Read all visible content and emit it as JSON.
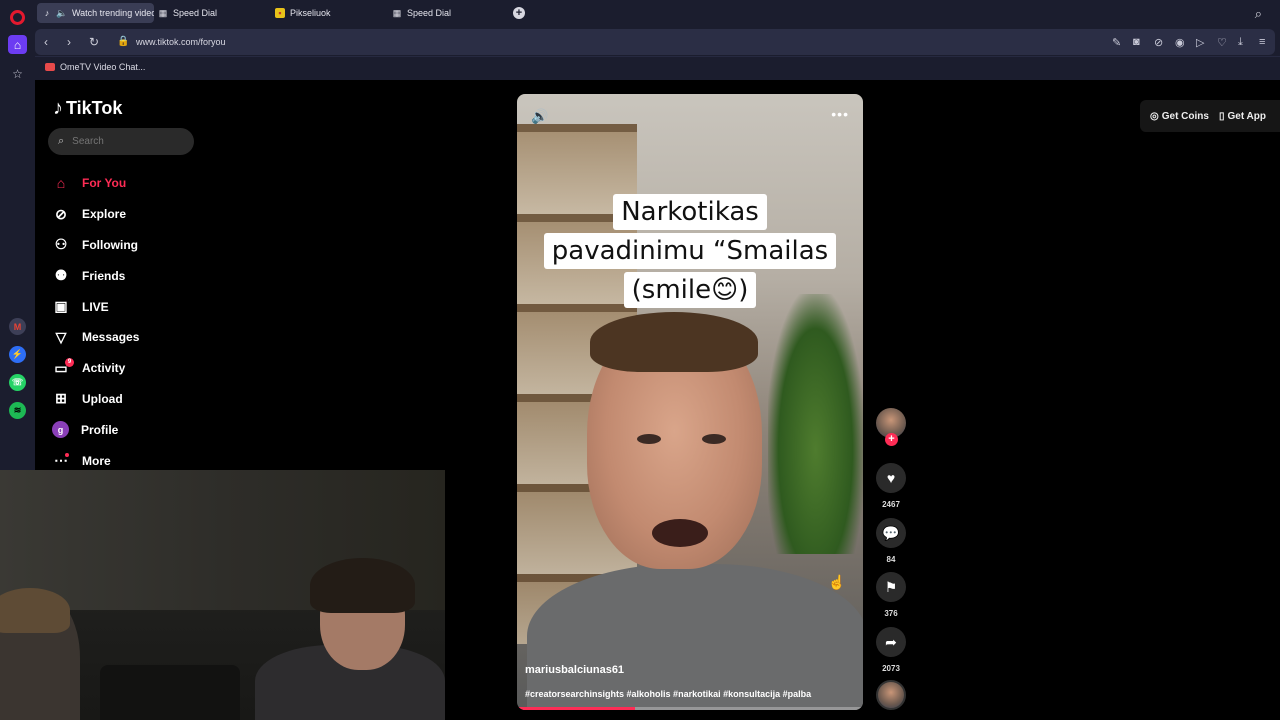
{
  "browser": {
    "tabs": [
      {
        "label": "Watch trending videos",
        "icon": "tiktok-icon",
        "active": true
      },
      {
        "label": "Speed Dial",
        "icon": "grid-icon",
        "active": false
      },
      {
        "label": "Pikseliuok",
        "icon": "pixel-icon",
        "active": false
      },
      {
        "label": "Speed Dial",
        "icon": "grid-icon",
        "active": false
      }
    ],
    "url": "www.tiktok.com/foryou",
    "bookmarks": [
      {
        "label": "OmeTV Video Chat..."
      }
    ]
  },
  "tiktok": {
    "brand": "TikTok",
    "search_placeholder": "Search",
    "nav": [
      {
        "label": "For You",
        "icon": "home-icon",
        "active": true
      },
      {
        "label": "Explore",
        "icon": "compass-icon"
      },
      {
        "label": "Following",
        "icon": "following-icon"
      },
      {
        "label": "Friends",
        "icon": "friends-icon"
      },
      {
        "label": "LIVE",
        "icon": "live-icon"
      },
      {
        "label": "Messages",
        "icon": "messages-icon"
      },
      {
        "label": "Activity",
        "icon": "activity-icon",
        "badge": "9"
      },
      {
        "label": "Upload",
        "icon": "upload-icon"
      },
      {
        "label": "Profile",
        "icon": "profile-avatar",
        "avatar_letter": "g"
      },
      {
        "label": "More",
        "icon": "more-icon"
      }
    ],
    "top_right": {
      "coins": "Get Coins",
      "app": "Get App"
    },
    "video": {
      "caption_lines": [
        "Narkotikas",
        "pavadinimu “Smailas",
        "(smile😊)"
      ],
      "author": "mariusbalciunas61",
      "hashtags": "#creatorsearchinsights #alkoholis #narkotikai #konsultacija #palba",
      "progress": 0.34
    },
    "actions": {
      "likes": "2467",
      "comments": "84",
      "saves": "376",
      "shares": "2073"
    }
  }
}
